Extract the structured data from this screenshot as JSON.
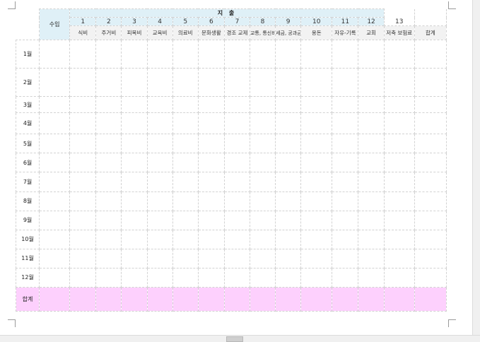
{
  "header": {
    "expense_title": "지 출",
    "income_label": "수입"
  },
  "columns": [
    {
      "num": "1",
      "name": "식비"
    },
    {
      "num": "2",
      "name": "주거비"
    },
    {
      "num": "3",
      "name": "피복비"
    },
    {
      "num": "4",
      "name": "교육비"
    },
    {
      "num": "5",
      "name": "의료비"
    },
    {
      "num": "6",
      "name": "문화생활"
    },
    {
      "num": "7",
      "name": "경조 교제"
    },
    {
      "num": "8",
      "name": "교통, 통신비"
    },
    {
      "num": "9",
      "name": "세금, 공과금"
    },
    {
      "num": "10",
      "name": "용돈"
    },
    {
      "num": "11",
      "name": "자유-기록"
    },
    {
      "num": "12",
      "name": "교회"
    },
    {
      "num": "13",
      "name": "저축 보험료"
    }
  ],
  "total_column": "합계",
  "months": [
    "1월",
    "2월",
    "3월",
    "4월",
    "5월",
    "6월",
    "7월",
    "8월",
    "9월",
    "10월",
    "11월",
    "12월"
  ],
  "total_row": "합계",
  "colors": {
    "header_blue": "#dff0f7",
    "header_grey": "#f2f2f2",
    "total_pink": "#fdd0fd"
  }
}
